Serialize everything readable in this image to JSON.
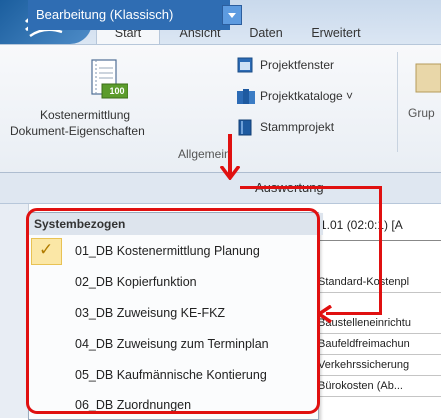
{
  "tabs": [
    "Start",
    "Ansicht",
    "Daten",
    "Erweitert"
  ],
  "ribbon": {
    "big_button_line1": "Kostenermittlung",
    "big_button_line2": "Dokument-Eigenschaften",
    "big_button_icon_text": "100",
    "items": [
      {
        "label": "Projektfenster",
        "icon": "window-icon"
      },
      {
        "label": "Projektkataloge ˅",
        "icon": "books-icon"
      },
      {
        "label": "Stammprojekt",
        "icon": "book-icon"
      }
    ],
    "group_label": "Allgemein",
    "partial_label": "Grup"
  },
  "bearbeitung": {
    "label": "Bearbeitung (Klassisch)",
    "next_tab": "Auswertung"
  },
  "content": {
    "doc_info": "1.01 (02:0:1) [A",
    "rows": [
      "Standard-Kostenpl",
      "Baustelleneinrichtu",
      "Baufeldfreimachun",
      "Verkehrssicherung",
      "Bürokosten (Ab..."
    ]
  },
  "dropdown": {
    "header": "Systembezogen",
    "items": [
      "01_DB Kostenermittlung Planung",
      "02_DB Kopierfunktion",
      "03_DB Zuweisung KE-FKZ",
      "04_DB Zuweisung zum Terminplan",
      "05_DB Kaufmännische Kontierung",
      "06_DB Zuordnungen"
    ],
    "selected_index": 0,
    "check_symbol": "✓"
  },
  "colors": {
    "accent_blue": "#2f6db3",
    "annotation_red": "#e01010",
    "selection": "#fbe7a6"
  }
}
